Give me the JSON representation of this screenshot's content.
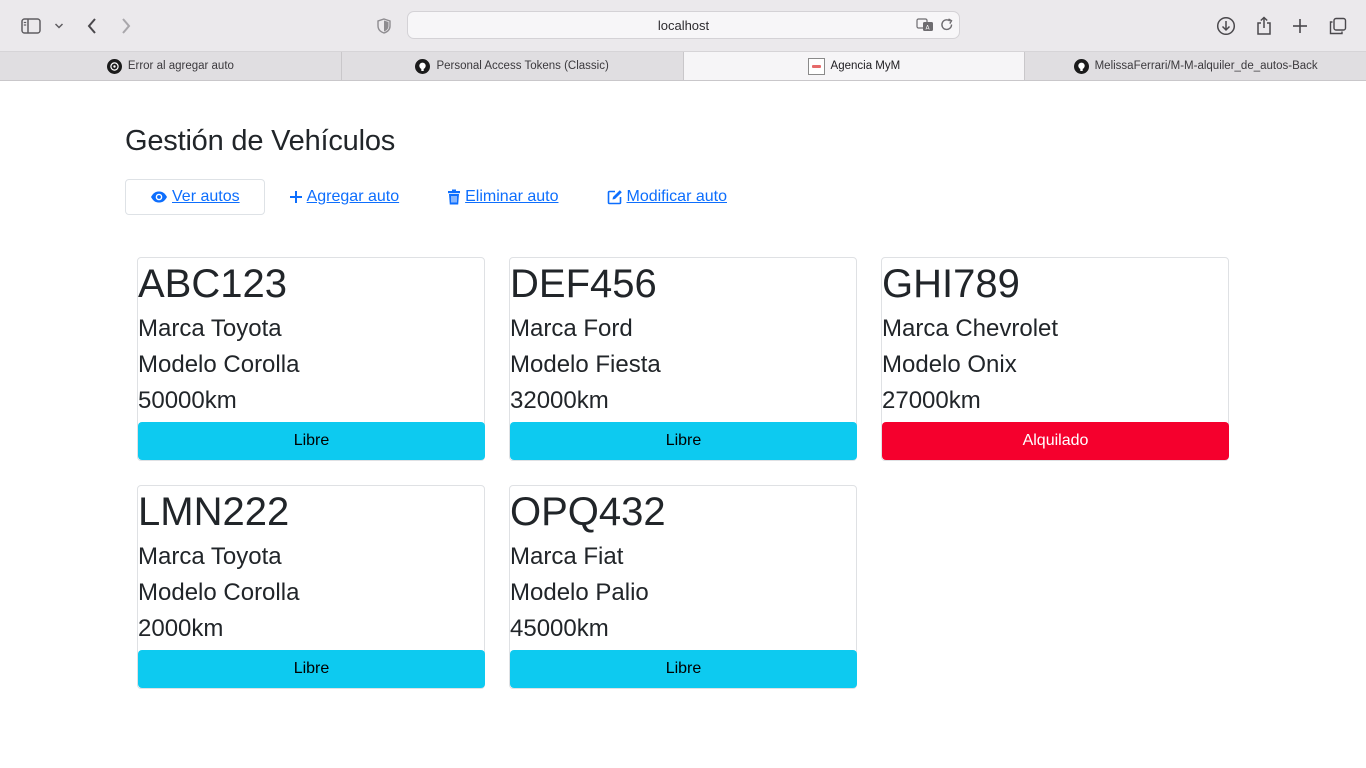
{
  "browser": {
    "url": "localhost",
    "tabs": [
      {
        "label": "Error al agregar auto",
        "active": false,
        "icon": "openai-icon"
      },
      {
        "label": "Personal Access Tokens (Classic)",
        "active": false,
        "icon": "github-icon"
      },
      {
        "label": "Agencia MyM",
        "active": true,
        "icon": "site-favicon"
      },
      {
        "label": "MelissaFerrari/M-M-alquiler_de_autos-Back",
        "active": false,
        "icon": "github-icon"
      }
    ]
  },
  "page": {
    "title": "Gestión de Vehículos",
    "nav": [
      {
        "label": "Ver autos",
        "icon": "eye-icon",
        "active": true
      },
      {
        "label": "Agregar auto",
        "icon": "plus-icon",
        "active": false
      },
      {
        "label": "Eliminar auto",
        "icon": "trash-icon",
        "active": false
      },
      {
        "label": "Modificar auto",
        "icon": "edit-icon",
        "active": false
      }
    ],
    "cars": [
      {
        "plate": "ABC123",
        "brand": "Marca Toyota",
        "model": "Modelo Corolla",
        "km": "50000km",
        "status": "Libre"
      },
      {
        "plate": "DEF456",
        "brand": "Marca Ford",
        "model": "Modelo Fiesta",
        "km": "32000km",
        "status": "Libre"
      },
      {
        "plate": "GHI789",
        "brand": "Marca Chevrolet",
        "model": "Modelo Onix",
        "km": "27000km",
        "status": "Alquilado"
      },
      {
        "plate": "LMN222",
        "brand": "Marca Toyota",
        "model": "Modelo Corolla",
        "km": "2000km",
        "status": "Libre"
      },
      {
        "plate": "OPQ432",
        "brand": "Marca Fiat",
        "model": "Modelo Palio",
        "km": "45000km",
        "status": "Libre"
      }
    ]
  },
  "colors": {
    "libre": "#0dcaf0",
    "alquilado": "#f5002d",
    "link": "#0d6efd"
  }
}
